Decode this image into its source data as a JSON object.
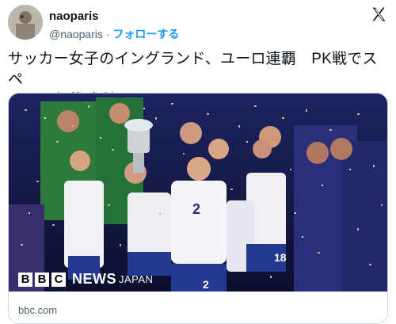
{
  "author": {
    "name": "naoparis",
    "handle": "@naoparis",
    "separator": "·",
    "follow_label": "フォローする"
  },
  "tweet": {
    "line1": "サッカー女子のイングランド、ユーロ連覇　PK戦でスペ",
    "line2": "インに劇的勝利"
  },
  "card": {
    "bbc_letters": [
      "B",
      "B",
      "C"
    ],
    "news_label": "NEWS",
    "japan_label": "JAPAN",
    "domain": "bbc.com"
  },
  "icons": {
    "x_logo": "x-logo-icon"
  },
  "colors": {
    "follow": "#1d9bf0",
    "text": "#0f1419",
    "muted": "#536471",
    "border": "#cfd9de"
  }
}
